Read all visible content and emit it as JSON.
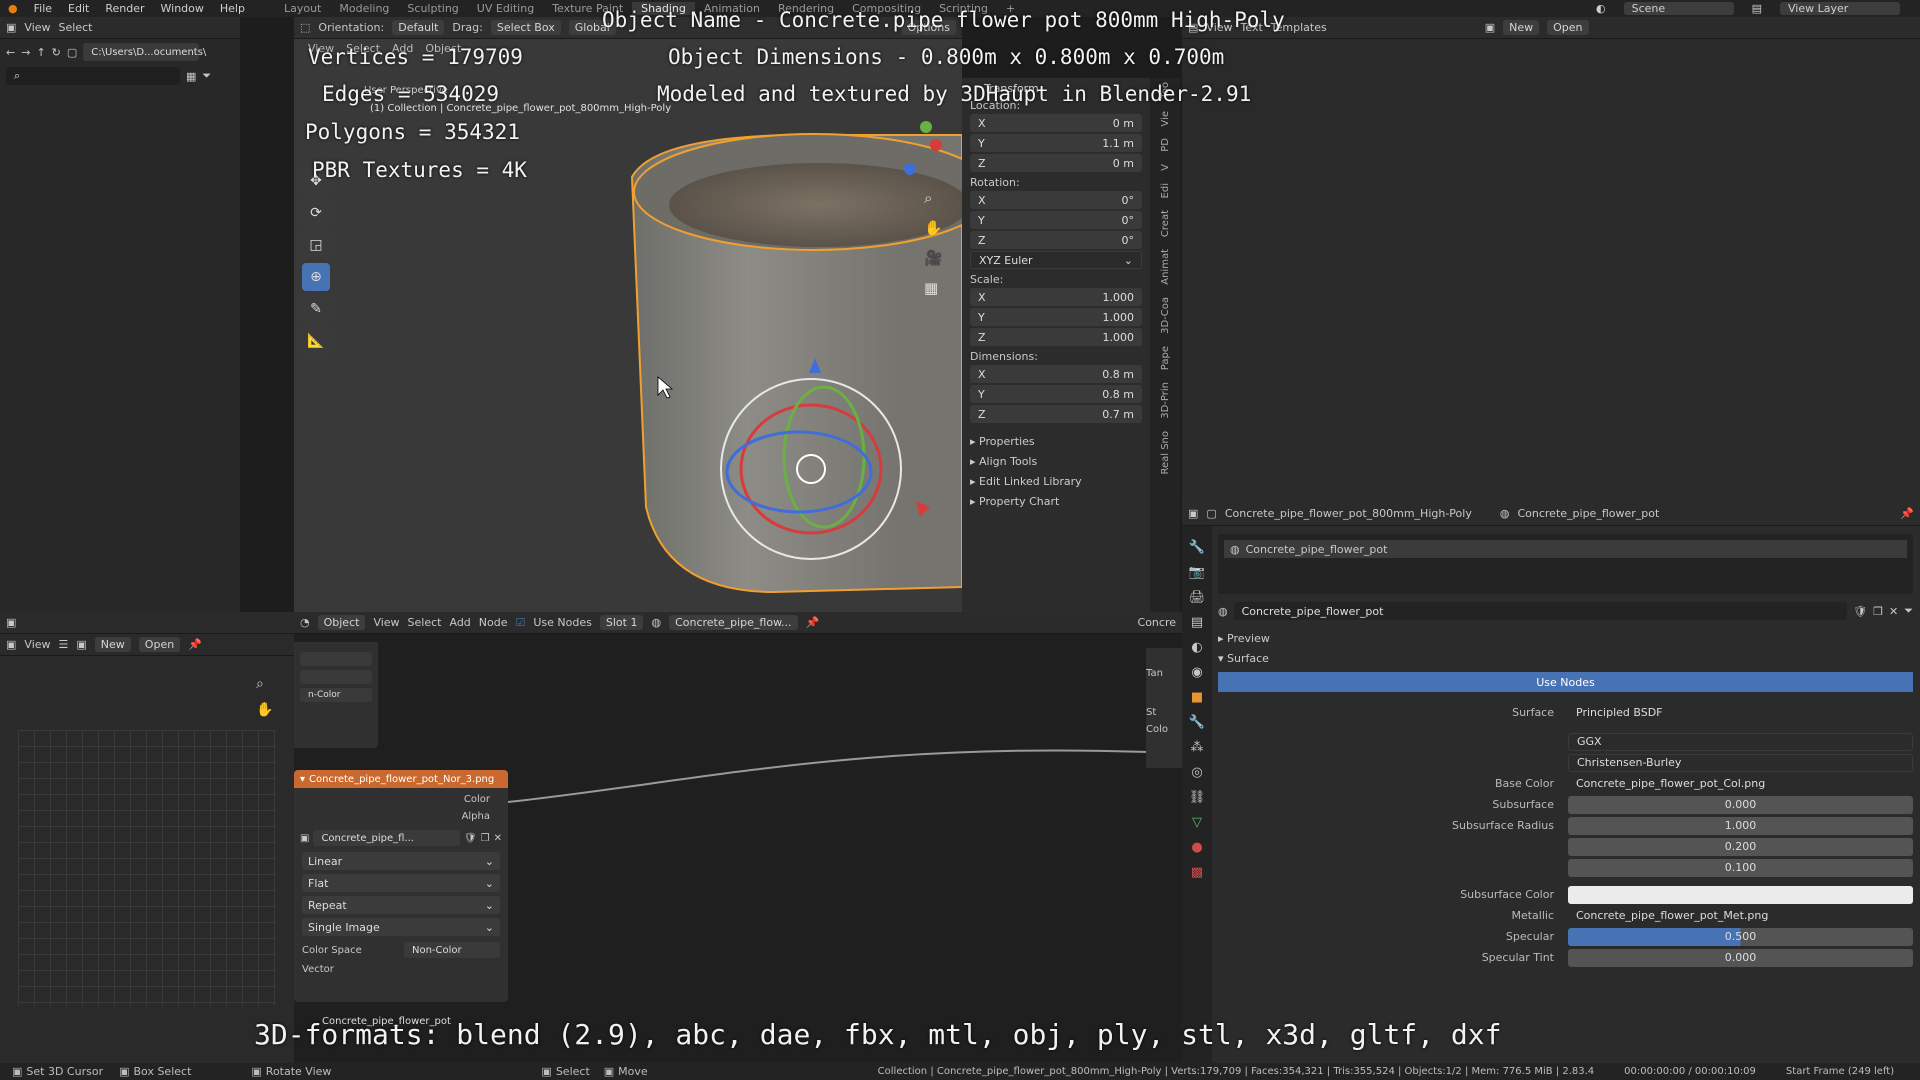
{
  "topmenu": [
    "File",
    "Edit",
    "Render",
    "Window",
    "Help"
  ],
  "workspaces": [
    "Layout",
    "Modeling",
    "Sculpting",
    "UV Editing",
    "Texture Paint",
    "Shading",
    "Animation",
    "Rendering",
    "Compositing",
    "Scripting"
  ],
  "active_workspace": "Shading",
  "scene": "Scene",
  "view_layer": "View Layer",
  "filebrowser": {
    "menu": [
      "View",
      "Select"
    ],
    "path": "C:\\Users\\D...ocuments\\"
  },
  "viewport_header": {
    "orientation_label": "Orientation:",
    "orientation": "Default",
    "drag_label": "Drag:",
    "drag": "Select Box",
    "transform": "Global",
    "options": "Options",
    "mode_menu": [
      "View",
      "Select",
      "Add",
      "Object"
    ]
  },
  "viewport": {
    "view_name": "User Perspective",
    "collection": "(1) Collection | Concrete_pipe_flower_pot_800mm_High-Poly"
  },
  "overlay": {
    "line1": "Object Name - Concrete.pipe flower pot 800mm High-Poly",
    "line2": "Object Dimensions - 0.800m x 0.800m x 0.700m",
    "line3": "Modeled and textured by 3DHaupt in Blender-2.91",
    "vertices": "Vertices = 179709",
    "edges": "Edges = 534029",
    "polygons": "Polygons = 354321",
    "pbr": "PBR Textures = 4K",
    "formats": "3D-formats: blend (2.9), abc, dae, fbx, mtl, obj, ply, stl, x3d, gltf, dxf"
  },
  "n_panel": {
    "transform": "Transform",
    "location_label": "Location:",
    "location": [
      {
        "axis": "X",
        "value": "0 m"
      },
      {
        "axis": "Y",
        "value": "1.1 m"
      },
      {
        "axis": "Z",
        "value": "0 m"
      }
    ],
    "rotation_label": "Rotation:",
    "rotation": [
      {
        "axis": "X",
        "value": "0°"
      },
      {
        "axis": "Y",
        "value": "0°"
      },
      {
        "axis": "Z",
        "value": "0°"
      }
    ],
    "rotation_mode": "XYZ Euler",
    "scale_label": "Scale:",
    "scale": [
      {
        "axis": "X",
        "value": "1.000"
      },
      {
        "axis": "Y",
        "value": "1.000"
      },
      {
        "axis": "Z",
        "value": "1.000"
      }
    ],
    "dimensions_label": "Dimensions:",
    "dimensions": [
      {
        "axis": "X",
        "value": "0.8 m"
      },
      {
        "axis": "Y",
        "value": "0.8 m"
      },
      {
        "axis": "Z",
        "value": "0.7 m"
      }
    ],
    "sections": [
      "Properties",
      "Align Tools",
      "Edit Linked Library",
      "Property Chart"
    ],
    "tabs": [
      "Too",
      "Vie",
      "PD",
      "V",
      "Edi",
      "Creat",
      "Animat",
      "3D-Coa",
      "Pape",
      "3D-Prin",
      "Real Sno"
    ]
  },
  "text_editor": {
    "menu": [
      "View",
      "Text",
      "Templates"
    ],
    "new": "New",
    "open": "Open"
  },
  "image_editor": {
    "view": "View",
    "new": "New",
    "open": "Open"
  },
  "node_editor": {
    "header": {
      "object": "Object",
      "menu": [
        "View",
        "Select",
        "Add",
        "Node"
      ],
      "use_nodes": "Use Nodes",
      "slot": "Slot 1",
      "material": "Concrete_pipe_flow...",
      "right_label": "Concre"
    },
    "node": {
      "title": "Concrete_pipe_flower_pot_Nor_3.png",
      "outputs": [
        "Color",
        "Alpha"
      ],
      "image": "Concrete_pipe_fl...",
      "options": [
        "Linear",
        "Flat",
        "Repeat",
        "Single Image"
      ],
      "color_space_label": "Color Space",
      "color_space": "Non-Color",
      "vector": "Vector"
    },
    "partial_node_field": "n-Color",
    "right_node": [
      "Tan",
      "St",
      "Colo"
    ],
    "bottom_label": "Concrete_pipe_flower_pot"
  },
  "properties": {
    "object": "Concrete_pipe_flower_pot_800mm_High-Poly",
    "material": "Concrete_pipe_flower_pot",
    "slot_item": "Concrete_pipe_flower_pot",
    "material_field": "Concrete_pipe_flower_pot",
    "preview": "Preview",
    "surface_section": "Surface",
    "use_nodes": "Use Nodes",
    "rows": [
      {
        "label": "Surface",
        "value": "Principled BSDF"
      },
      {
        "label": "",
        "value": "GGX"
      },
      {
        "label": "",
        "value": "Christensen-Burley"
      },
      {
        "label": "Base Color",
        "value": "Concrete_pipe_flower_pot_Col.png"
      },
      {
        "label": "Subsurface",
        "value": "0.000"
      },
      {
        "label": "Subsurface Radius",
        "value": "1.000"
      },
      {
        "label": "",
        "value": "0.200"
      },
      {
        "label": "",
        "value": "0.100"
      },
      {
        "label": "Subsurface Color",
        "value": ""
      },
      {
        "label": "Metallic",
        "value": "Concrete_pipe_flower_pot_Met.png"
      },
      {
        "label": "Specular",
        "value": "0.500"
      },
      {
        "label": "Specular Tint",
        "value": "0.000"
      }
    ]
  },
  "status": {
    "left": [
      "Set 3D Cursor",
      "Box Select",
      "Rotate View",
      "Select",
      "Move"
    ],
    "center": "Collection | Concrete_pipe_flower_pot_800mm_High-Poly | Verts:179,709 | Faces:354,321 | Tris:355,524 | Objects:1/2 | Mem: 776.5 MiB | 2.83.4",
    "timecode": "00:00:00:00 / 00:00:10:09",
    "frame": "Start Frame (249 left)"
  },
  "colors": {
    "accent": "#4772b3",
    "node_header": "#c9692f",
    "selection": "#f0a030"
  }
}
